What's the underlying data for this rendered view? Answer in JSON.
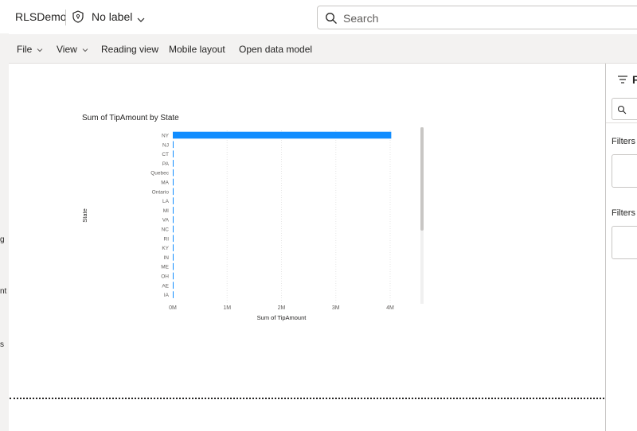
{
  "topbar": {
    "app_title": "RLSDemo",
    "sensitivity_label": "No label",
    "search_placeholder": "Search"
  },
  "menubar": {
    "items": [
      {
        "label": "File",
        "has_chevron": true
      },
      {
        "label": "View",
        "has_chevron": true
      },
      {
        "label": "Reading view",
        "has_chevron": false
      },
      {
        "label": "Mobile layout",
        "has_chevron": false
      },
      {
        "label": "Open data model",
        "has_chevron": false
      }
    ]
  },
  "left_clipped_text": [
    "g",
    "nt",
    "s"
  ],
  "filter_pane": {
    "title": "F",
    "headings": [
      "Filters",
      "Filters"
    ]
  },
  "colors": {
    "bar": "#118dff",
    "menubar_bg": "#f3f2f1",
    "text": "#252423"
  },
  "chart_data": {
    "type": "bar",
    "orientation": "horizontal",
    "title": "Sum of TipAmount by State",
    "xlabel": "Sum of TipAmount",
    "ylabel": "State",
    "xlim": [
      0,
      4000000
    ],
    "xticks": [
      "0M",
      "1M",
      "2M",
      "3M",
      "4M"
    ],
    "categories": [
      "NY",
      "NJ",
      "CT",
      "PA",
      "Quebec",
      "MA",
      "Ontario",
      "LA",
      "MI",
      "VA",
      "NC",
      "RI",
      "KY",
      "IN",
      "ME",
      "OH",
      "AE",
      "IA"
    ],
    "values": [
      4020000,
      9000,
      6000,
      4000,
      3000,
      2500,
      2000,
      1500,
      1200,
      1100,
      1000,
      900,
      800,
      700,
      600,
      500,
      400,
      300
    ],
    "grid": true
  }
}
